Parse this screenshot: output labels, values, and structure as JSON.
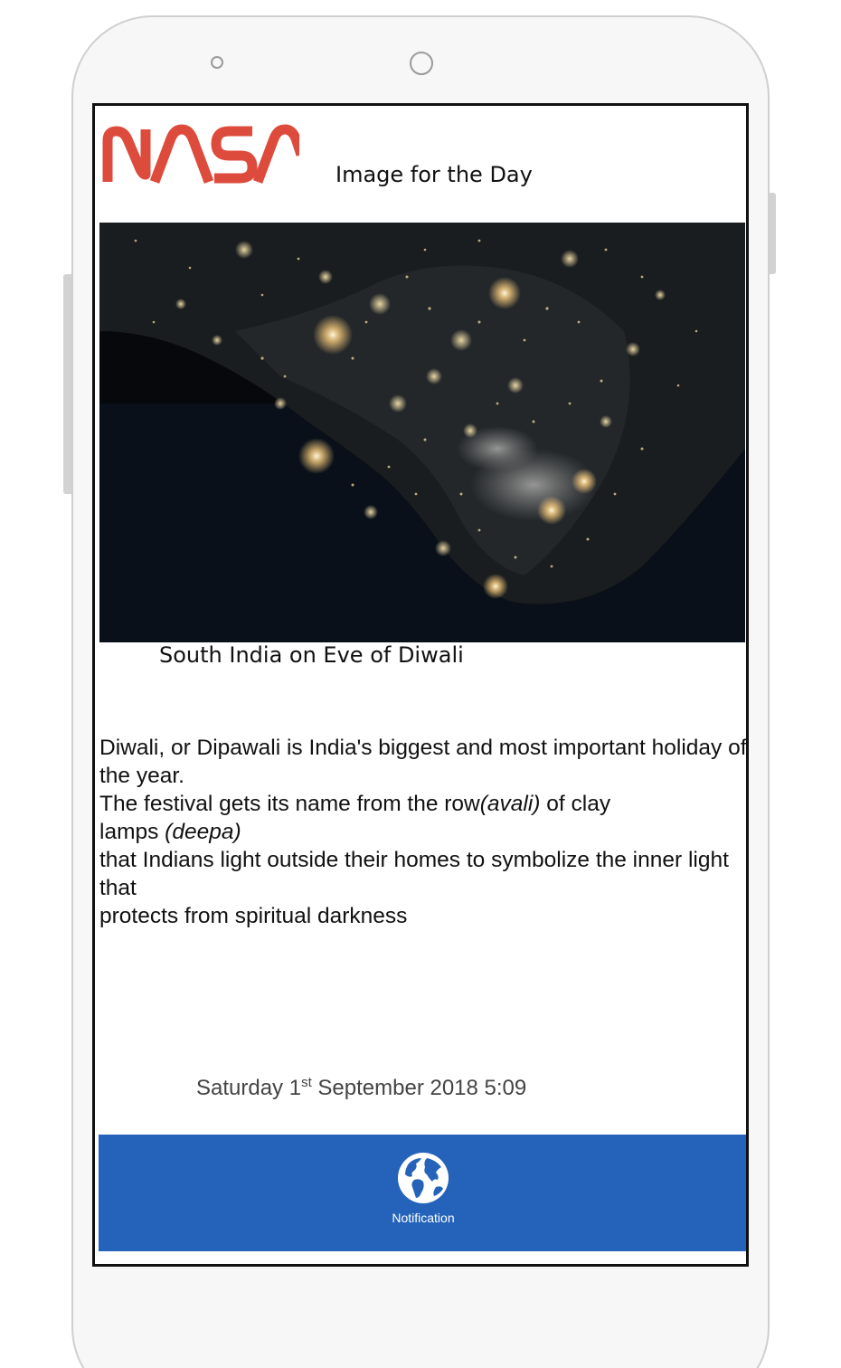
{
  "header": {
    "logo_text": "NASA",
    "title": "Image for the Day"
  },
  "image": {
    "caption": "South India on Eve of Diwali"
  },
  "description": {
    "line1": "Diwali, or Dipawali is India's biggest and most important holiday of the year.",
    "line2_pre": " The festival gets its name from the row",
    "line2_em": "(avali)",
    "line2_post": " of clay",
    "line3_pre": "lamps ",
    "line3_em": "(deepa)",
    "line4": " that Indians light outside their homes to symbolize the inner light that",
    "line5": "protects from spiritual darkness"
  },
  "date": {
    "prefix": "Saturday 1",
    "ordinal": "st",
    "suffix": " September 2018 5:09"
  },
  "bottom_nav": {
    "notification_label": "Notification",
    "icon": "globe-icon"
  },
  "colors": {
    "logo_red": "#dd4b3c",
    "nav_blue": "#2463b9"
  }
}
